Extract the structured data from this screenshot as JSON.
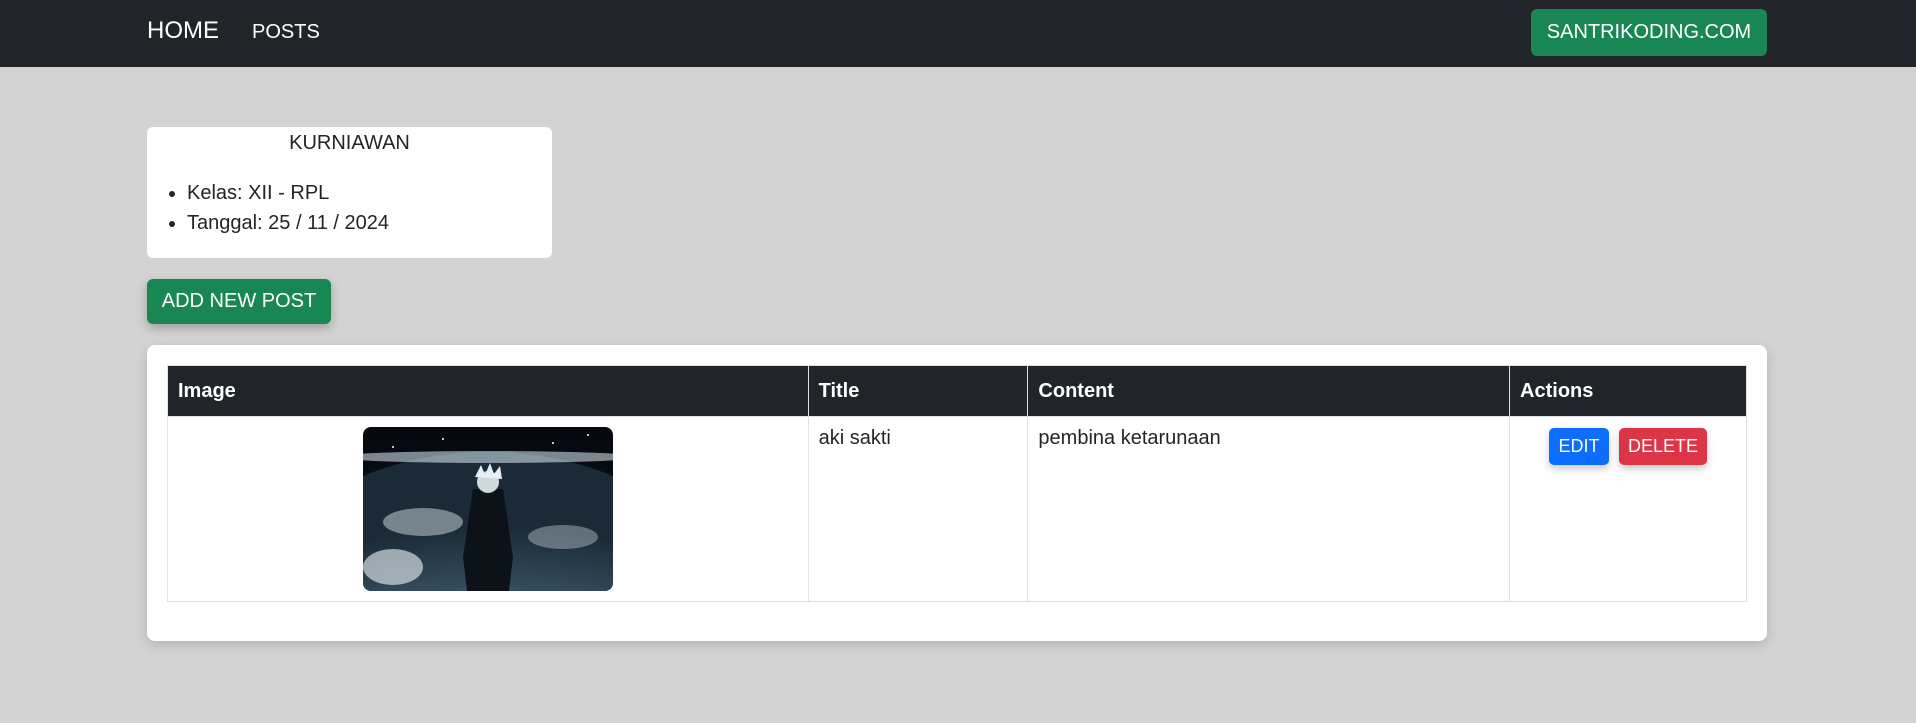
{
  "nav": {
    "home": "HOME",
    "posts": "POSTS",
    "brand_button": "SANTRIKODING.COM"
  },
  "profile": {
    "name": "KURNIAWAN",
    "items": [
      "Kelas: XII - RPL",
      "Tanggal: 25 / 11 / 2024"
    ]
  },
  "add_button": "ADD NEW POST",
  "table": {
    "headers": [
      "Image",
      "Title",
      "Content",
      "Actions"
    ],
    "rows": [
      {
        "title": "aki sakti",
        "content": "pembina ketarunaan",
        "edit_label": "EDIT",
        "delete_label": "DELETE"
      }
    ]
  },
  "colors": {
    "navbar": "#212529",
    "success": "#198754",
    "primary": "#0d6efd",
    "danger": "#dc3545",
    "background": "#d3d3d3"
  }
}
